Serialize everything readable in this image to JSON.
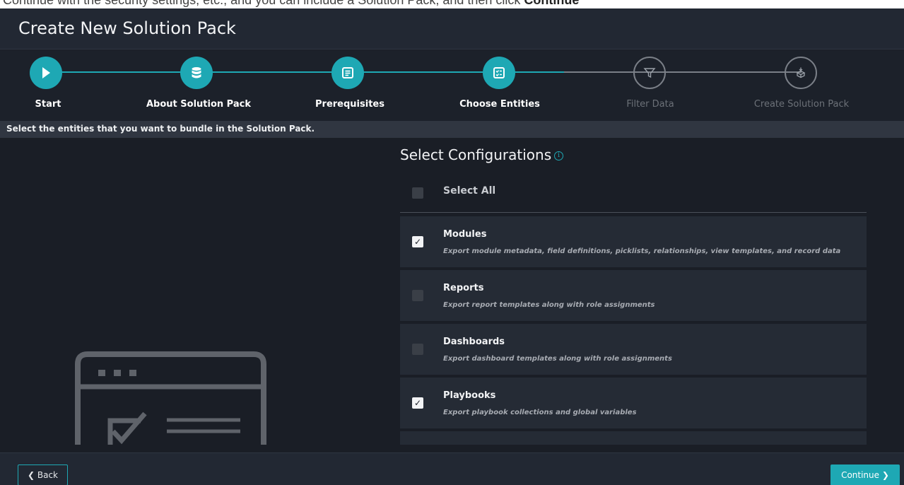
{
  "top_strip_text_prefix": "Continue with the security settings, etc., and you can include a Solution Pack, and then click ",
  "top_strip_text_bold": "Continue",
  "window": {
    "title": "Create New Solution Pack"
  },
  "wizard": {
    "steps": [
      {
        "label": "Start",
        "icon": "play-icon",
        "state": "done"
      },
      {
        "label": "About Solution Pack",
        "icon": "database-icon",
        "state": "done"
      },
      {
        "label": "Prerequisites",
        "icon": "list-doc-icon",
        "state": "done"
      },
      {
        "label": "Choose Entities",
        "icon": "checklist-icon",
        "state": "current"
      },
      {
        "label": "Filter Data",
        "icon": "filter-icon",
        "state": "todo"
      },
      {
        "label": "Create Solution Pack",
        "icon": "package-icon",
        "state": "todo"
      }
    ],
    "accent_color": "#1ea8b4"
  },
  "instruction": "Select the entities that you want to bundle in the Solution Pack.",
  "configurations": {
    "title": "Select Configurations",
    "select_all_label": "Select All",
    "select_all_checked": false,
    "items": [
      {
        "title": "Modules",
        "description": "Export module metadata, field definitions, picklists, relationships, view templates, and record data",
        "checked": true
      },
      {
        "title": "Reports",
        "description": "Export report templates along with role assignments",
        "checked": false
      },
      {
        "title": "Dashboards",
        "description": "Export dashboard templates along with role assignments",
        "checked": false
      },
      {
        "title": "Playbooks",
        "description": "Export playbook collections and global variables",
        "checked": true
      }
    ]
  },
  "footer": {
    "back_label": "Back",
    "continue_label": "Continue"
  }
}
